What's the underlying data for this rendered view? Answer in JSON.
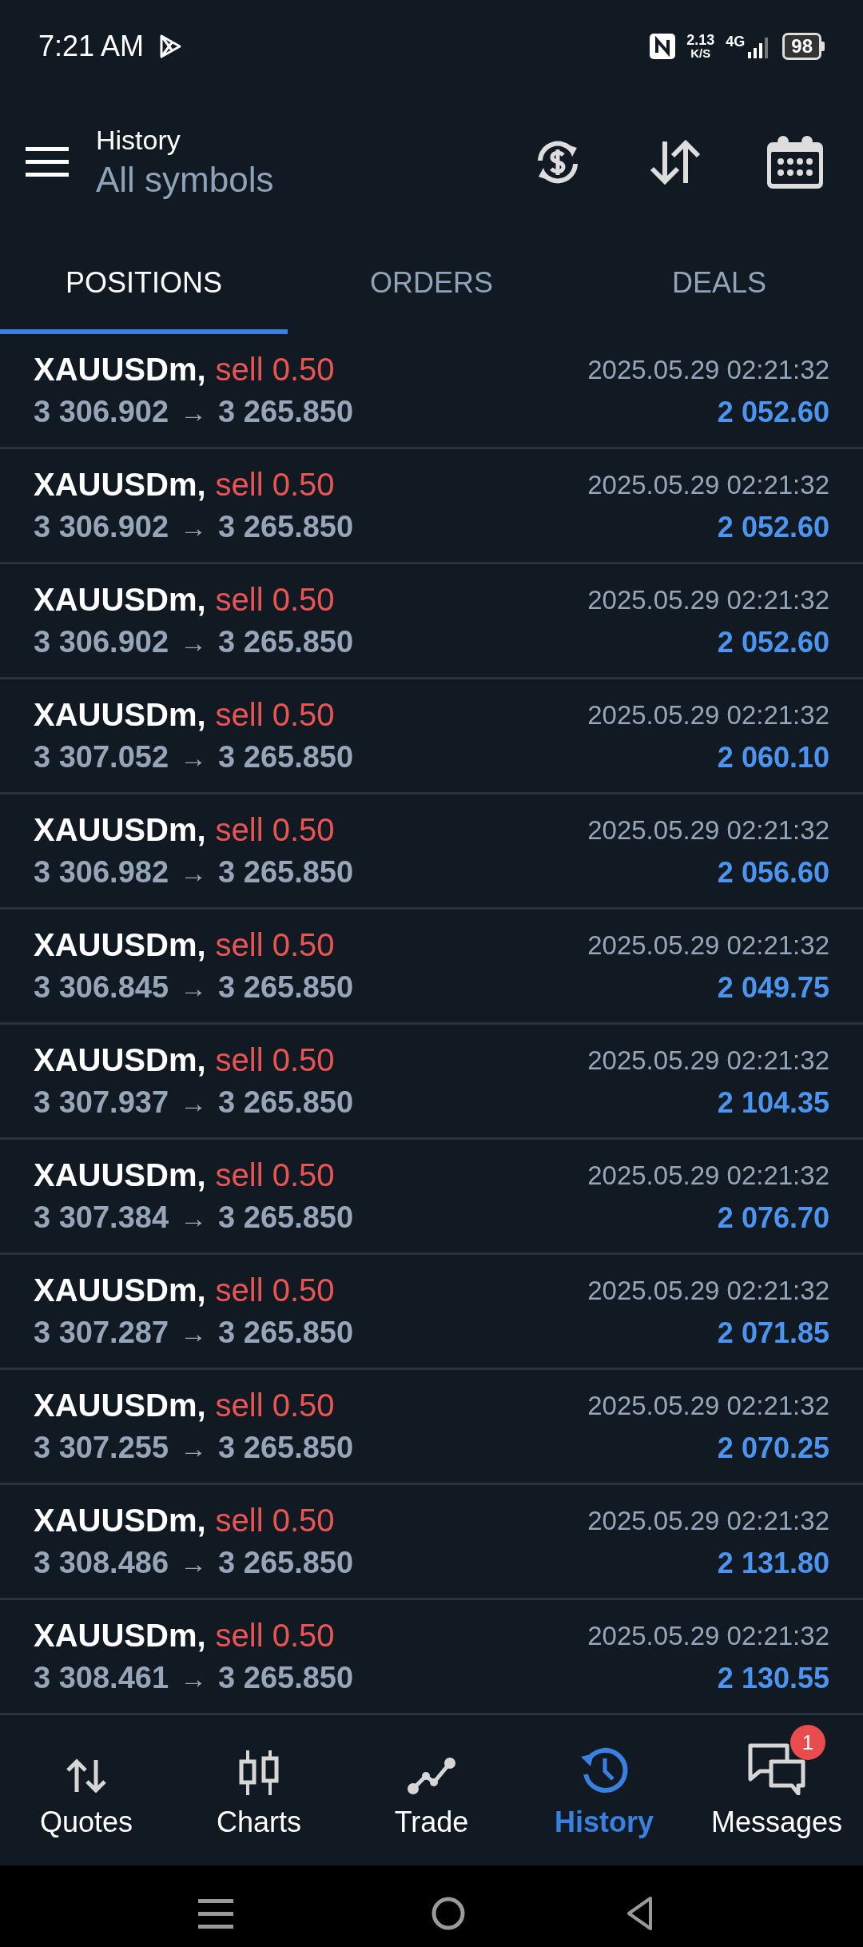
{
  "status_bar": {
    "time": "7:21 AM",
    "speed_value": "2.13",
    "speed_unit": "K/S",
    "network": "4G",
    "battery": "98"
  },
  "header": {
    "title": "History",
    "subtitle": "All symbols"
  },
  "tabs": [
    {
      "label": "POSITIONS",
      "selected": true
    },
    {
      "label": "ORDERS",
      "selected": false
    },
    {
      "label": "DEALS",
      "selected": false
    }
  ],
  "positions": [
    {
      "symbol": "XAUUSDm,",
      "side": "sell",
      "volume": "0.50",
      "open_price": "3 306.902",
      "arrow": "→",
      "close_price": "3 265.850",
      "time": "2025.05.29 02:21:32",
      "profit": "2 052.60"
    },
    {
      "symbol": "XAUUSDm,",
      "side": "sell",
      "volume": "0.50",
      "open_price": "3 306.902",
      "arrow": "→",
      "close_price": "3 265.850",
      "time": "2025.05.29 02:21:32",
      "profit": "2 052.60"
    },
    {
      "symbol": "XAUUSDm,",
      "side": "sell",
      "volume": "0.50",
      "open_price": "3 306.902",
      "arrow": "→",
      "close_price": "3 265.850",
      "time": "2025.05.29 02:21:32",
      "profit": "2 052.60"
    },
    {
      "symbol": "XAUUSDm,",
      "side": "sell",
      "volume": "0.50",
      "open_price": "3 307.052",
      "arrow": "→",
      "close_price": "3 265.850",
      "time": "2025.05.29 02:21:32",
      "profit": "2 060.10"
    },
    {
      "symbol": "XAUUSDm,",
      "side": "sell",
      "volume": "0.50",
      "open_price": "3 306.982",
      "arrow": "→",
      "close_price": "3 265.850",
      "time": "2025.05.29 02:21:32",
      "profit": "2 056.60"
    },
    {
      "symbol": "XAUUSDm,",
      "side": "sell",
      "volume": "0.50",
      "open_price": "3 306.845",
      "arrow": "→",
      "close_price": "3 265.850",
      "time": "2025.05.29 02:21:32",
      "profit": "2 049.75"
    },
    {
      "symbol": "XAUUSDm,",
      "side": "sell",
      "volume": "0.50",
      "open_price": "3 307.937",
      "arrow": "→",
      "close_price": "3 265.850",
      "time": "2025.05.29 02:21:32",
      "profit": "2 104.35"
    },
    {
      "symbol": "XAUUSDm,",
      "side": "sell",
      "volume": "0.50",
      "open_price": "3 307.384",
      "arrow": "→",
      "close_price": "3 265.850",
      "time": "2025.05.29 02:21:32",
      "profit": "2 076.70"
    },
    {
      "symbol": "XAUUSDm,",
      "side": "sell",
      "volume": "0.50",
      "open_price": "3 307.287",
      "arrow": "→",
      "close_price": "3 265.850",
      "time": "2025.05.29 02:21:32",
      "profit": "2 071.85"
    },
    {
      "symbol": "XAUUSDm,",
      "side": "sell",
      "volume": "0.50",
      "open_price": "3 307.255",
      "arrow": "→",
      "close_price": "3 265.850",
      "time": "2025.05.29 02:21:32",
      "profit": "2 070.25"
    },
    {
      "symbol": "XAUUSDm,",
      "side": "sell",
      "volume": "0.50",
      "open_price": "3 308.486",
      "arrow": "→",
      "close_price": "3 265.850",
      "time": "2025.05.29 02:21:32",
      "profit": "2 131.80"
    },
    {
      "symbol": "XAUUSDm,",
      "side": "sell",
      "volume": "0.50",
      "open_price": "3 308.461",
      "arrow": "→",
      "close_price": "3 265.850",
      "time": "2025.05.29 02:21:32",
      "profit": "2 130.55"
    }
  ],
  "bottom_nav": [
    {
      "kind": "quotes",
      "label": "Quotes",
      "selected": false
    },
    {
      "kind": "charts",
      "label": "Charts",
      "selected": false
    },
    {
      "kind": "trade",
      "label": "Trade",
      "selected": false
    },
    {
      "kind": "history",
      "label": "History",
      "selected": true
    },
    {
      "kind": "messages",
      "label": "Messages",
      "selected": false,
      "badge": "1"
    }
  ]
}
